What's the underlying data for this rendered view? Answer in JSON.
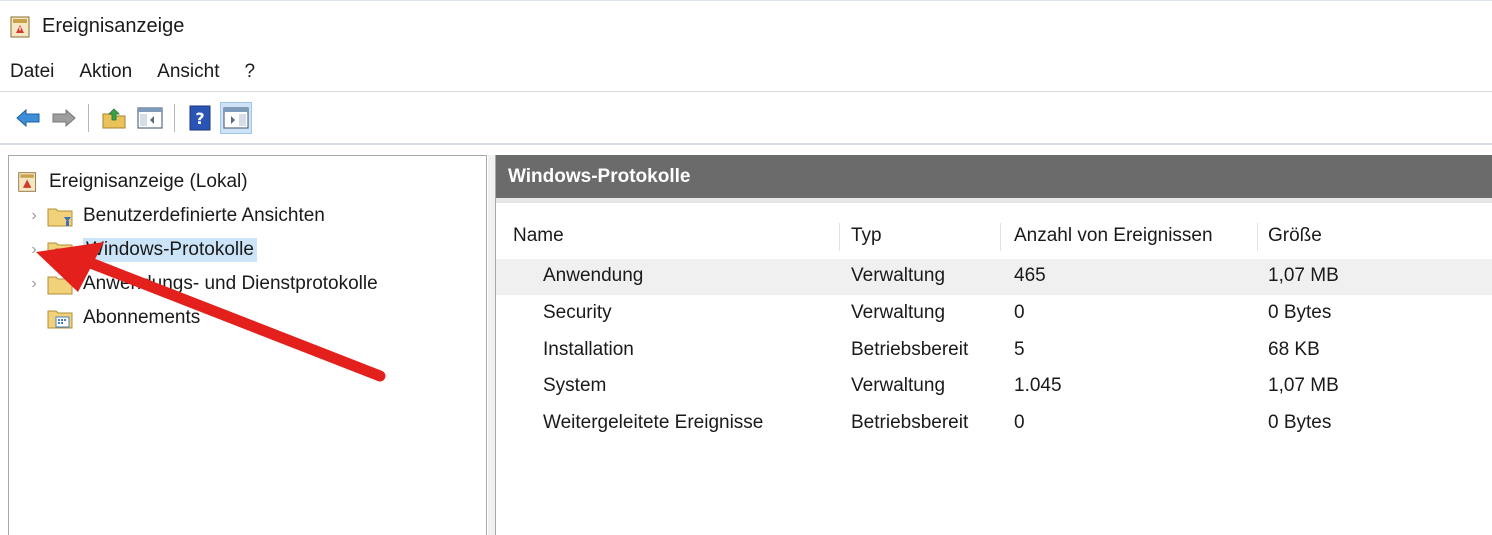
{
  "window": {
    "title": "Ereignisanzeige",
    "icon": "event-viewer-icon"
  },
  "menu": [
    "Datei",
    "Aktion",
    "Ansicht",
    "?"
  ],
  "toolbar": {
    "buttons": [
      "back-arrow-icon",
      "forward-arrow-icon",
      "up-folder-icon",
      "show-hide-console-tree-icon",
      "help-icon",
      "show-hide-action-pane-icon"
    ]
  },
  "tree": {
    "root": "Ereignisanzeige (Lokal)",
    "items": [
      {
        "label": "Benutzerdefinierte Ansichten",
        "icon": "custom-views-folder-icon"
      },
      {
        "label": "Windows-Protokolle",
        "icon": "windows-logs-folder-icon"
      },
      {
        "label": "Anwendungs- und Dienstprotokolle",
        "icon": "app-service-logs-folder-icon"
      },
      {
        "label": "Abonnements",
        "icon": "subscriptions-icon"
      }
    ],
    "selected": "Windows-Protokolle"
  },
  "detail": {
    "title": "Windows-Protokolle",
    "columns": [
      "Name",
      "Typ",
      "Anzahl von Ereignissen",
      "Größe"
    ],
    "rows": [
      [
        "Anwendung",
        "Verwaltung",
        "465",
        "1,07 MB"
      ],
      [
        "Security",
        "Verwaltung",
        "0",
        "0 Bytes"
      ],
      [
        "Installation",
        "Betriebsbereit",
        "5",
        "68 KB"
      ],
      [
        "System",
        "Verwaltung",
        "1.045",
        "1,07 MB"
      ],
      [
        "Weitergeleitete Ereignisse",
        "Betriebsbereit",
        "0",
        "0 Bytes"
      ]
    ]
  },
  "annotation": {
    "type": "red-arrow",
    "color": "#e3201b"
  },
  "colors": {
    "selection": "#cce4f7",
    "header_bg": "#6b6b6b",
    "arrow": "#e3201b"
  }
}
